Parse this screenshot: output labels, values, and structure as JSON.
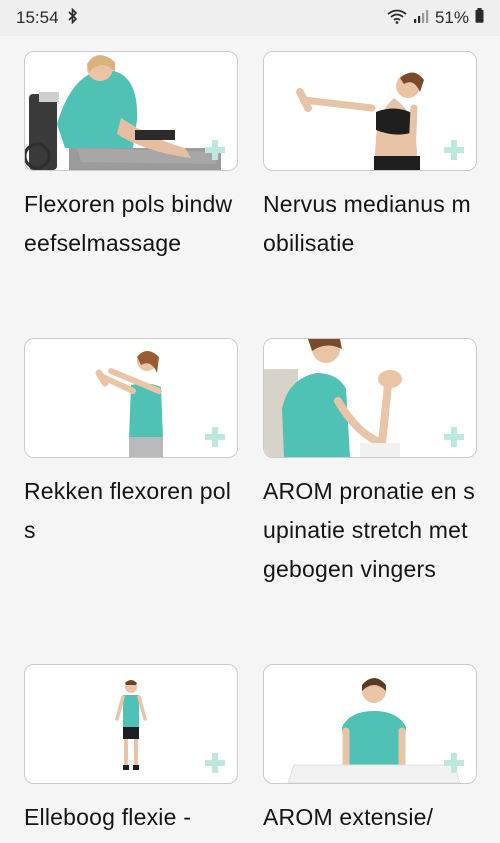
{
  "status_bar": {
    "time": "15:54",
    "battery": "51%",
    "icons": [
      "bluetooth-icon",
      "wifi-icon",
      "signal-icon",
      "battery-icon"
    ]
  },
  "exercises": [
    {
      "title": "Flexoren pols bindweefselmassage",
      "icon": "add-icon"
    },
    {
      "title": "Nervus medianus mobilisatie",
      "icon": "add-icon"
    },
    {
      "title": "Rekken flexoren pols",
      "icon": "add-icon"
    },
    {
      "title": "AROM pronatie en supinatie stretch met gebogen vingers",
      "icon": "add-icon"
    },
    {
      "title": "Elleboog flexie -",
      "icon": "add-icon"
    },
    {
      "title": "AROM extensie/",
      "icon": "add-icon"
    }
  ],
  "colors": {
    "accent_plus": "#bfe8dd",
    "shirt": "#4fc1b5",
    "background": "#f4f5f4"
  }
}
